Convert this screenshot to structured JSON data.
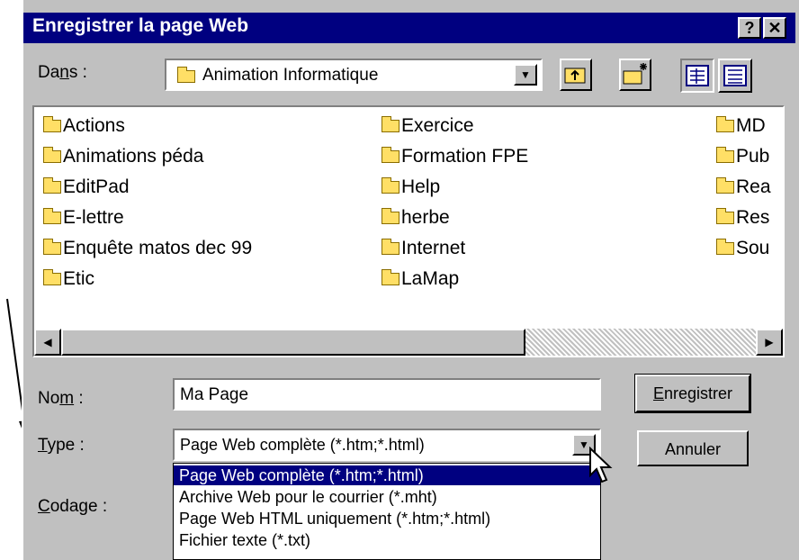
{
  "dialog": {
    "title": "Enregistrer la page Web",
    "help_glyph": "?",
    "close_glyph": "✕"
  },
  "location": {
    "label_pre": "Da",
    "label_ul": "n",
    "label_post": "s :",
    "current": "Animation Informatique"
  },
  "files": [
    {
      "name": "Actions"
    },
    {
      "name": "Animations péda"
    },
    {
      "name": "EditPad"
    },
    {
      "name": "E-lettre"
    },
    {
      "name": "Enquête matos dec 99"
    },
    {
      "name": "Etic"
    },
    {
      "name": "Exercice"
    },
    {
      "name": "Formation FPE"
    },
    {
      "name": "Help"
    },
    {
      "name": "herbe"
    },
    {
      "name": "Internet"
    },
    {
      "name": "LaMap"
    },
    {
      "name": "MD"
    },
    {
      "name": "Pub"
    },
    {
      "name": "Rea"
    },
    {
      "name": "Res"
    },
    {
      "name": "Sou"
    }
  ],
  "form": {
    "name_label_pre": "No",
    "name_label_ul": "m",
    "name_label_post": " :",
    "name_value": "Ma Page",
    "type_label_ul": "T",
    "type_label_post": "ype :",
    "type_value": "Page Web complète (*.htm;*.html)",
    "encoding_label_ul": "C",
    "encoding_label_post": "odage :"
  },
  "buttons": {
    "save_ul": "E",
    "save_post": "nregistrer",
    "cancel": "Annuler"
  },
  "type_options": [
    "Page Web complète (*.htm;*.html)",
    "Archive Web pour le courrier (*.mht)",
    "Page Web  HTML uniquement (*.htm;*.html)",
    "Fichier texte (*.txt)"
  ]
}
